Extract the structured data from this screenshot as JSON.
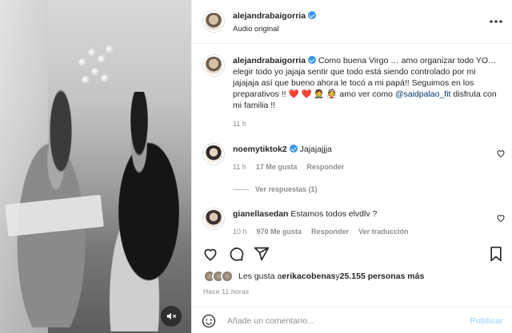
{
  "post": {
    "username": "alejandrabaigorria",
    "audio": "Audio original",
    "caption_text_1": "Como buena Virgo … amo organizar todo YO… elegir todo yo jajaja sentir que todo está siendo controlado por mi jajajaja así que bueno ahora le tocó a mi papá!! Seguimos en los preparativos !! ❤️ ❤️ 🤵 👰 amo ver como ",
    "caption_mention": "@saidpalao_fit",
    "caption_text_2": " disfruta con mi familia !!",
    "caption_time": "11 h"
  },
  "comments": [
    {
      "username": "noemytiktok2",
      "text": "Jajajajjja",
      "time": "11 h",
      "likes": "17 Me gusta",
      "reply": "Responder",
      "view_replies": "Ver respuestas (1)"
    },
    {
      "username": "gianellasedan",
      "text": "Estamos todos elvdlv ?",
      "time": "10 h",
      "likes": "970 Me gusta",
      "reply": "Responder",
      "translate": "Ver traducción"
    }
  ],
  "likes_line": {
    "prefix": "Les gusta a ",
    "user": "erikacobenas",
    "mid": " y ",
    "count": "25.155 personas más"
  },
  "posted_ago": "Hace 11 horas",
  "compose": {
    "placeholder": "Añade un comentario...",
    "publish": "Publicar"
  },
  "icons": {
    "more": "more-options-icon",
    "like": "heart-icon",
    "comment": "comment-icon",
    "share": "share-icon",
    "save": "bookmark-icon",
    "mute": "speaker-muted-icon",
    "emoji": "emoji-icon",
    "verified": "verified-badge-icon"
  },
  "colors": {
    "verified": "#3897f0",
    "link": "#00376b",
    "muted_text": "#8e8e8e",
    "publish": "#b3dbff"
  }
}
